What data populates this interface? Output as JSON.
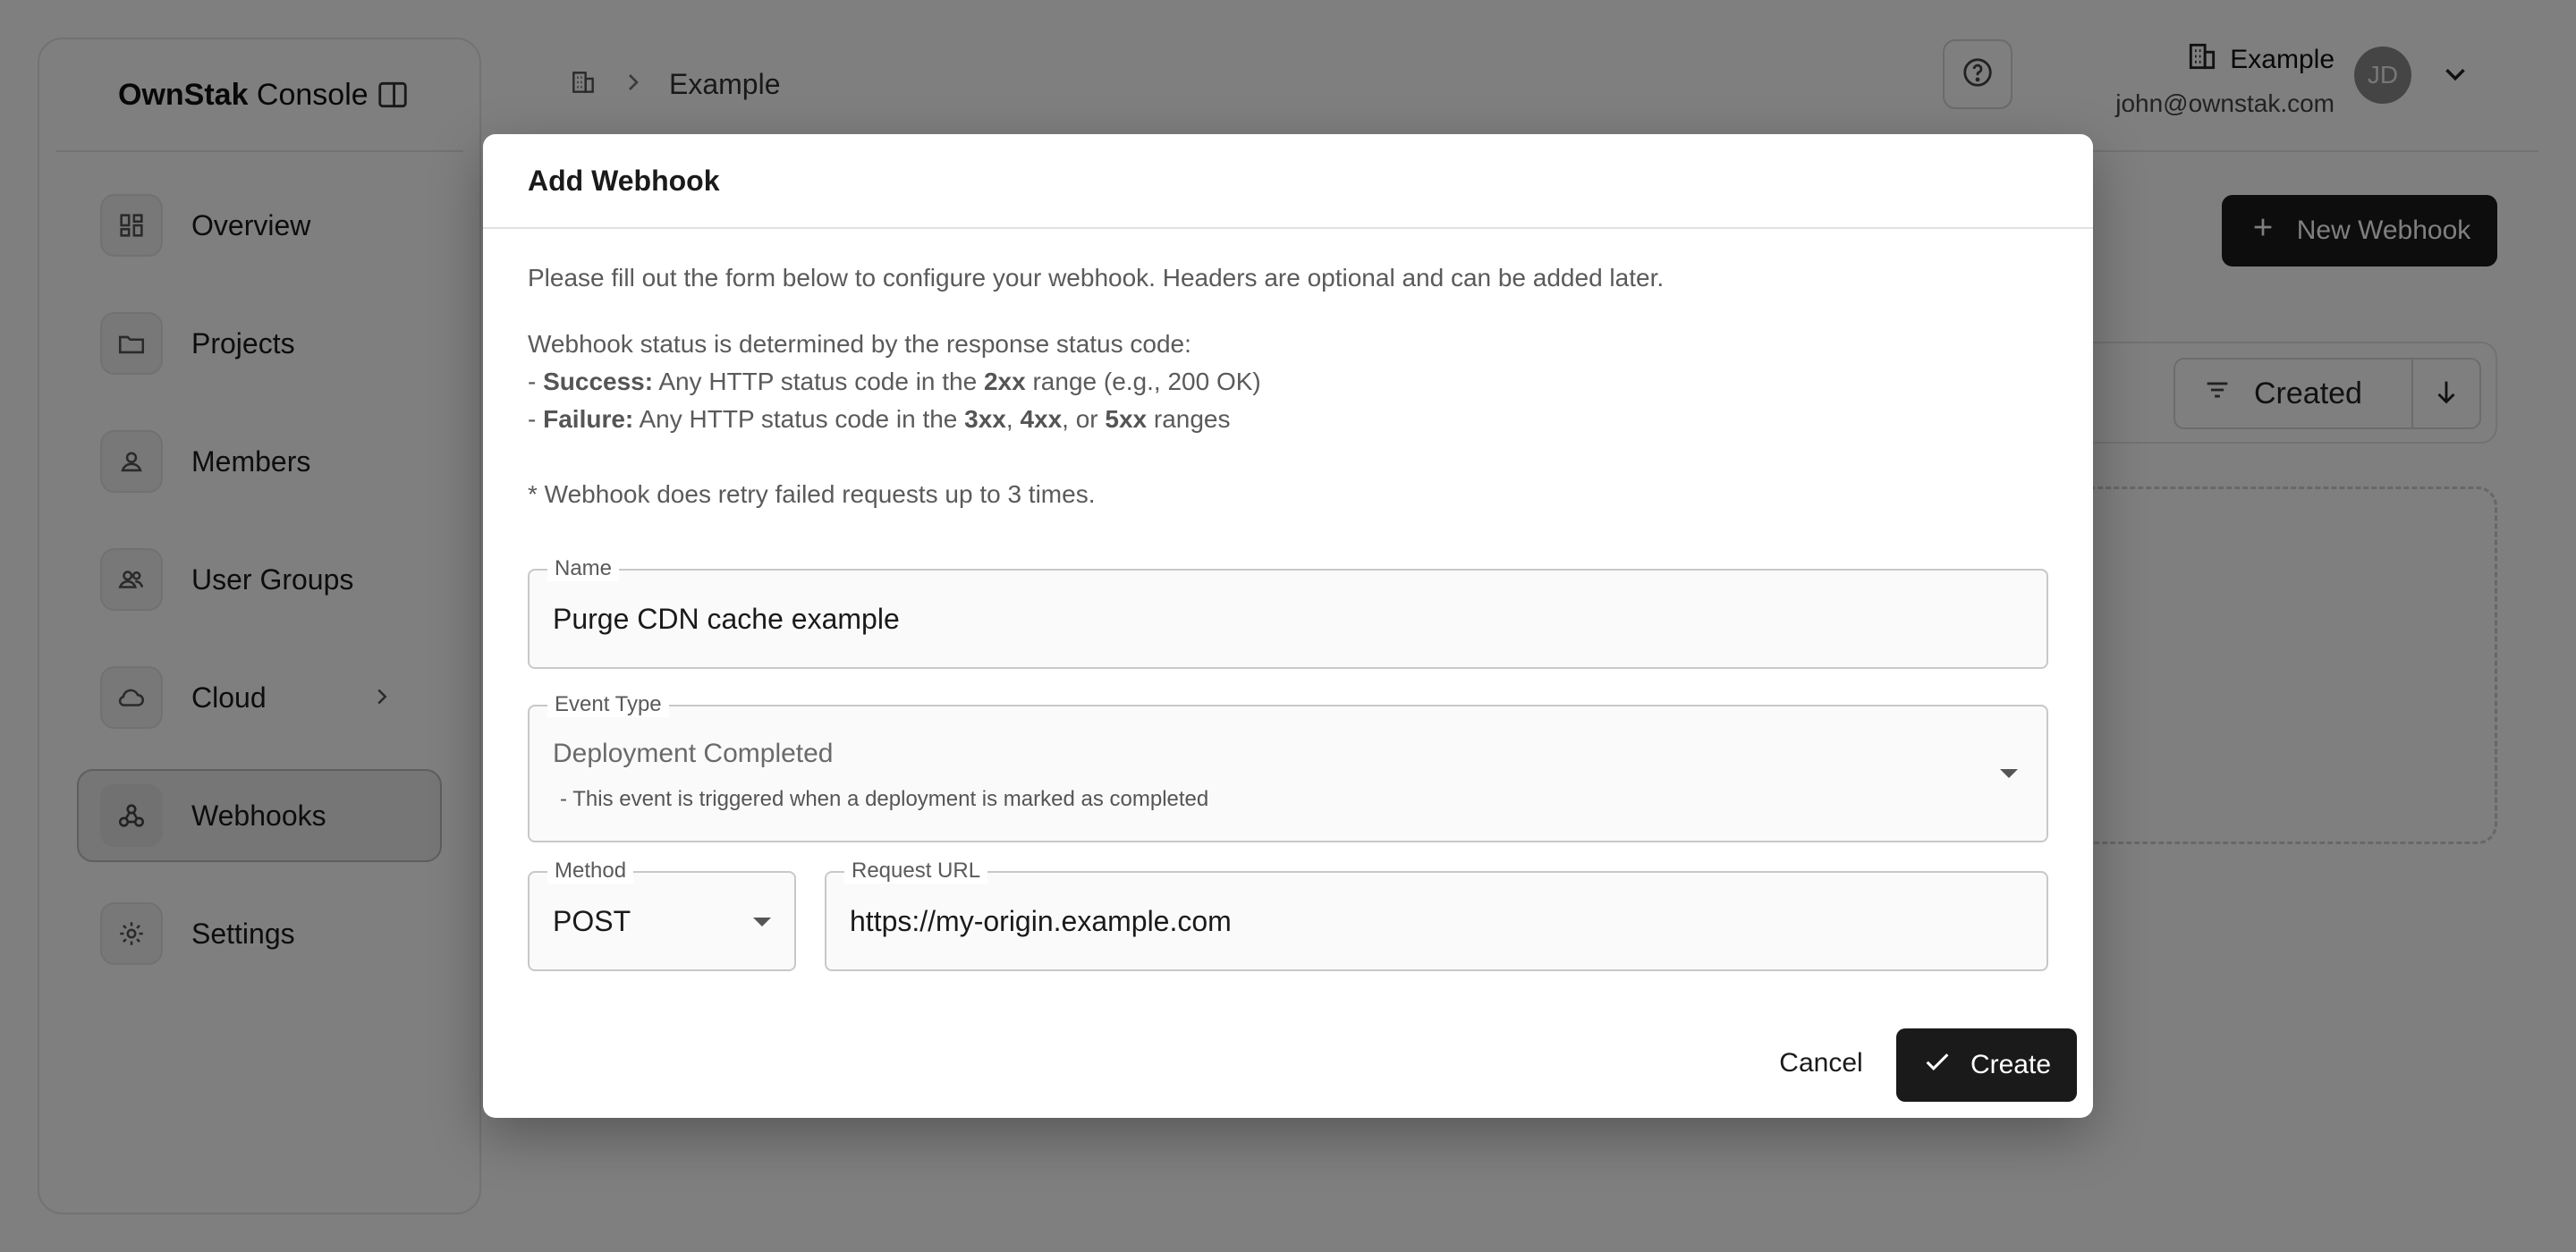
{
  "sidebar": {
    "brand_bold": "OwnStak",
    "brand_rest": " Console",
    "items": [
      {
        "label": "Overview"
      },
      {
        "label": "Projects"
      },
      {
        "label": "Members"
      },
      {
        "label": "User Groups"
      },
      {
        "label": "Cloud"
      },
      {
        "label": "Webhooks"
      },
      {
        "label": "Settings"
      }
    ]
  },
  "header": {
    "breadcrumb": "Example",
    "org_name": "Example",
    "email": "john@ownstak.com",
    "avatar_initials": "JD"
  },
  "page": {
    "new_webhook_label": "New Webhook",
    "sort_label": "Created"
  },
  "modal": {
    "title": "Add Webhook",
    "intro": "Please fill out the form below to configure your webhook. Headers are optional and can be added later.",
    "status_heading": "Webhook status is determined by the response status code:",
    "success_prefix": "- ",
    "success_label": "Success:",
    "success_text_a": " Any HTTP status code in the ",
    "success_code": "2xx",
    "success_text_b": " range (e.g., 200 OK)",
    "failure_prefix": "- ",
    "failure_label": "Failure:",
    "failure_text_a": " Any HTTP status code in the ",
    "failure_code_1": "3xx",
    "failure_sep_1": ", ",
    "failure_code_2": "4xx",
    "failure_sep_2": ", or ",
    "failure_code_3": "5xx",
    "failure_text_b": " ranges",
    "retry_note": "* Webhook does retry failed requests up to 3 times.",
    "name_label": "Name",
    "name_value": "Purge CDN cache example",
    "event_label": "Event Type",
    "event_value": "Deployment Completed",
    "event_desc": " - This event is triggered when a deployment is marked as completed",
    "method_label": "Method",
    "method_value": "POST",
    "url_label": "Request URL",
    "url_value": "https://my-origin.example.com",
    "cancel_label": "Cancel",
    "create_label": "Create"
  }
}
